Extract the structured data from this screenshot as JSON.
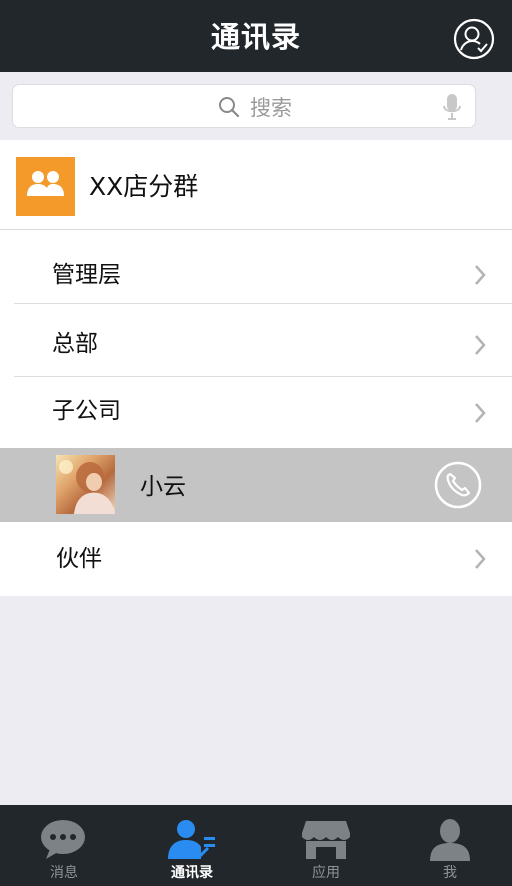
{
  "header": {
    "title": "通讯录",
    "profile_icon": "user-profile-icon"
  },
  "search": {
    "placeholder": "搜索",
    "icons": [
      "search-icon",
      "microphone-icon"
    ]
  },
  "group": {
    "label": "XX店分群",
    "icon": "group-icon",
    "icon_color": "#F39A2B"
  },
  "list": {
    "items": [
      {
        "label": "管理层"
      },
      {
        "label": "总部"
      },
      {
        "label": "子公司"
      }
    ],
    "contact": {
      "label": "小云",
      "icon": "phone-icon"
    },
    "partner": {
      "label": "伙伴"
    }
  },
  "tabbar": {
    "tabs": [
      {
        "label": "消息",
        "icon": "chat-bubble-icon"
      },
      {
        "label": "通讯录",
        "icon": "contacts-icon",
        "active": true
      },
      {
        "label": "应用",
        "icon": "store-icon"
      },
      {
        "label": "我",
        "icon": "person-icon"
      }
    ],
    "active_color": "#2A8CF0"
  }
}
